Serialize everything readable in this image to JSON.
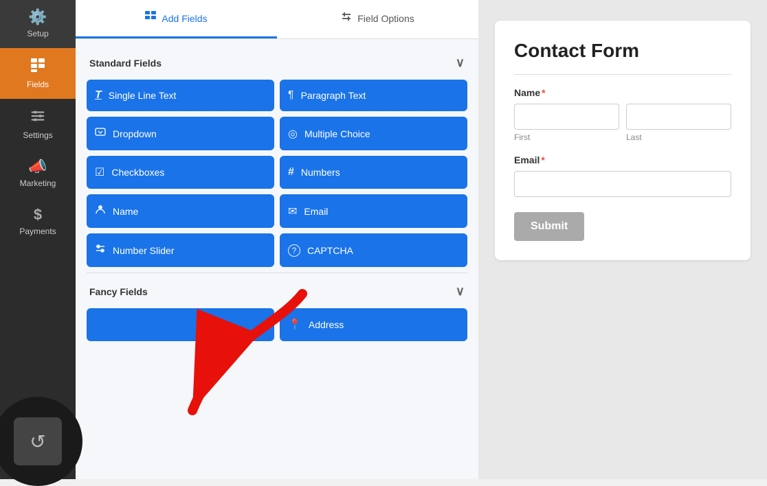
{
  "sidebar": {
    "items": [
      {
        "id": "setup",
        "label": "Setup",
        "icon": "⚙️",
        "active": false
      },
      {
        "id": "fields",
        "label": "Fields",
        "icon": "▦",
        "active": true
      },
      {
        "id": "settings",
        "label": "Settings",
        "icon": "⚙",
        "active": false
      },
      {
        "id": "marketing",
        "label": "Marketing",
        "icon": "📣",
        "active": false
      },
      {
        "id": "payments",
        "label": "Payments",
        "icon": "$",
        "active": false
      }
    ],
    "history_icon": "↺"
  },
  "tabs": [
    {
      "id": "add-fields",
      "label": "Add Fields",
      "icon": "▦",
      "active": true
    },
    {
      "id": "field-options",
      "label": "Field Options",
      "icon": "≡",
      "active": false
    }
  ],
  "standard_fields": {
    "section_label": "Standard Fields",
    "fields": [
      {
        "id": "single-line-text",
        "label": "Single Line Text",
        "icon": "T̲"
      },
      {
        "id": "paragraph-text",
        "label": "Paragraph Text",
        "icon": "¶"
      },
      {
        "id": "dropdown",
        "label": "Dropdown",
        "icon": "⊡"
      },
      {
        "id": "multiple-choice",
        "label": "Multiple Choice",
        "icon": "◎"
      },
      {
        "id": "checkboxes",
        "label": "Checkboxes",
        "icon": "☑"
      },
      {
        "id": "numbers",
        "label": "Numbers",
        "icon": "#"
      },
      {
        "id": "name",
        "label": "Name",
        "icon": "👤"
      },
      {
        "id": "email",
        "label": "Email",
        "icon": "✉"
      },
      {
        "id": "number-slider",
        "label": "Number Slider",
        "icon": "⊟"
      },
      {
        "id": "captcha",
        "label": "CAPTCHA",
        "icon": "?"
      }
    ]
  },
  "fancy_fields": {
    "section_label": "Fancy Fields",
    "fields": [
      {
        "id": "address",
        "label": "Address",
        "icon": "📍"
      }
    ]
  },
  "form_preview": {
    "title": "Contact Form",
    "fields": [
      {
        "type": "name",
        "label": "Name",
        "required": true,
        "subfields": [
          {
            "placeholder": "",
            "sub_label": "First"
          },
          {
            "placeholder": "",
            "sub_label": "Last"
          }
        ]
      },
      {
        "type": "email",
        "label": "Email",
        "required": true
      }
    ],
    "submit_label": "Submit"
  }
}
